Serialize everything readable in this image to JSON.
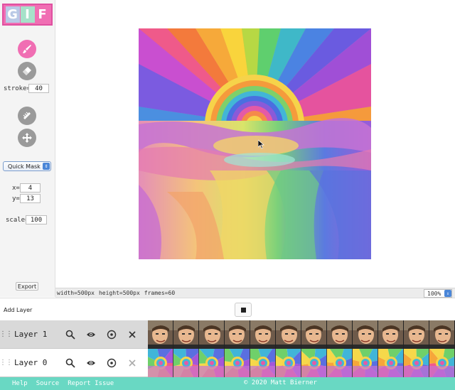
{
  "logo": {
    "letters": [
      "G",
      "I",
      "F"
    ]
  },
  "tools": {
    "stroke_label": "stroke=",
    "stroke_value": "40",
    "mode_select": "Quick Mask",
    "x_label": "x=",
    "x_value": "4",
    "y_label": "y=",
    "y_value": "13",
    "scale_label": "scale=",
    "scale_value": "100",
    "export_label": "Export"
  },
  "status": {
    "width": "width=500px",
    "height": "height=500px",
    "frames": "frames=60",
    "zoom": "100%"
  },
  "timeline": {
    "add_layer_label": "Add Layer",
    "layers": [
      {
        "name": "Layer 1"
      },
      {
        "name": "Layer 0"
      }
    ]
  },
  "footer": {
    "links": [
      "Help",
      "Source",
      "Report Issue"
    ],
    "copyright": "© 2020  Matt Bierner"
  },
  "colors": {
    "accent": "#f06eb3",
    "footer": "#69d8c3",
    "tool_inactive": "#9a9a9a",
    "select_blue": "#4a86d8"
  }
}
